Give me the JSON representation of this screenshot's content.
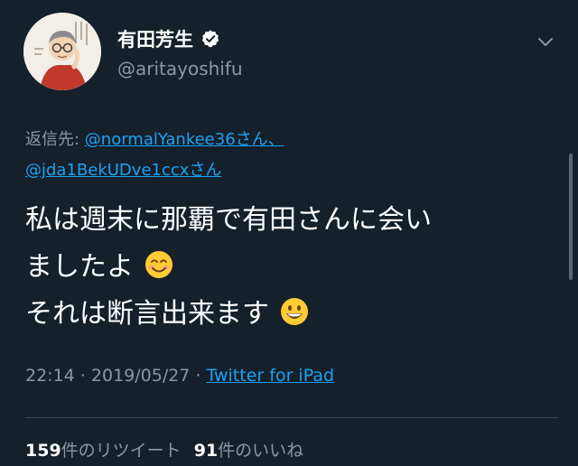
{
  "user": {
    "display_name": "有田芳生",
    "handle": "@aritayoshifu",
    "verified": true,
    "avatar_icon": "avatar-illustration-icon"
  },
  "reply": {
    "prefix": "返信先: ",
    "mentions": [
      "@normalYankee36さん、",
      "@jda1BekUDve1ccxさん"
    ]
  },
  "tweet": {
    "lines": [
      "私は週末に那覇で有田さんに会い",
      "ましたよ",
      "それは断言出来ます"
    ],
    "emojis": [
      "smiling-face-emoji",
      "grinning-face-emoji"
    ]
  },
  "meta": {
    "time": "22:14",
    "separator1": " · ",
    "date": "2019/05/27",
    "separator2": " · ",
    "source": "Twitter for iPad"
  },
  "stats": {
    "retweet_count": "159",
    "retweet_label": "件のリツイート",
    "like_count": "91",
    "like_label": "件のいいね"
  },
  "colors": {
    "background": "#15202b",
    "accent": "#1da1f2",
    "secondary_text": "#8899a6"
  }
}
